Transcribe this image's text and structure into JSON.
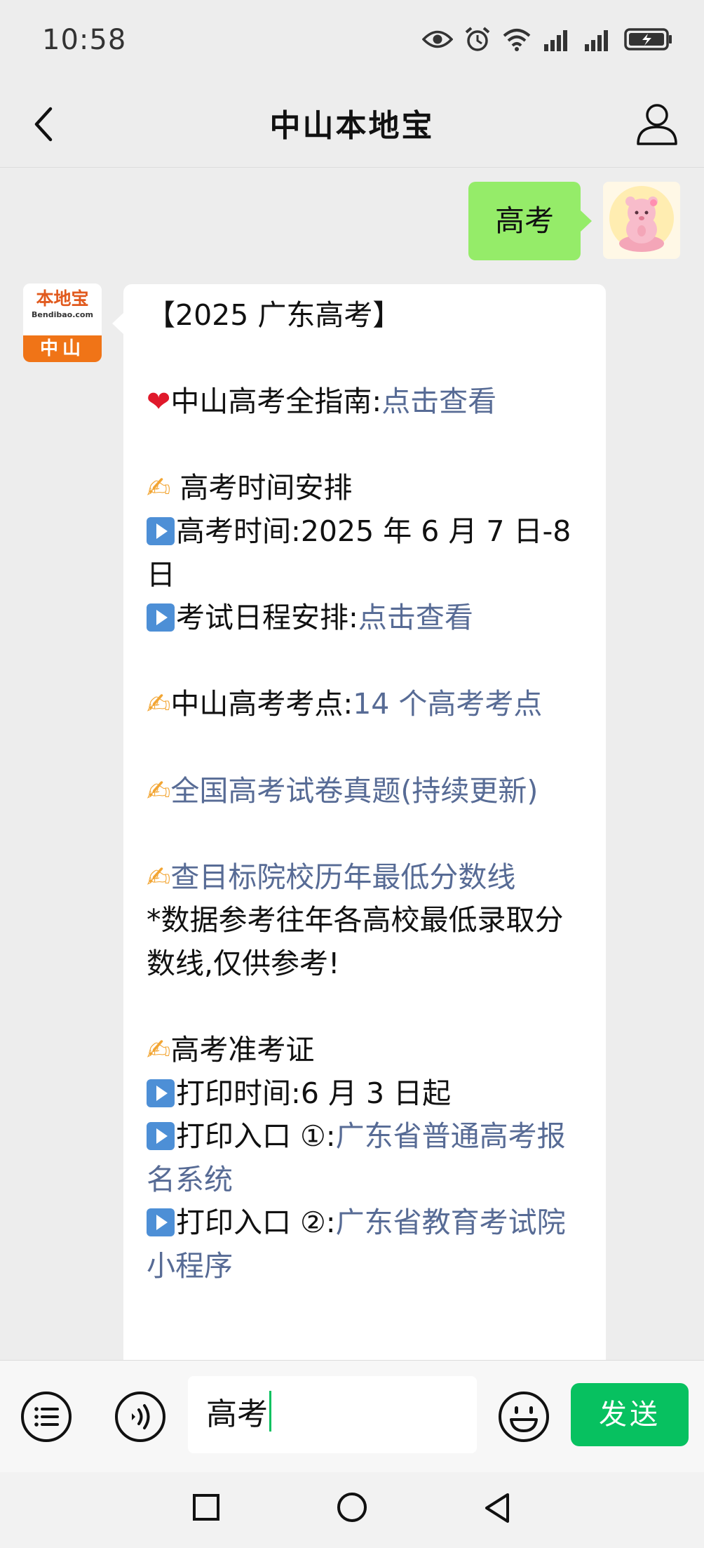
{
  "status_bar": {
    "time": "10:58",
    "icons": [
      "eye-icon",
      "alarm-icon",
      "wifi-icon",
      "signal-icon",
      "signal-icon",
      "battery-charging-icon"
    ]
  },
  "nav": {
    "title": "中山本地宝",
    "back_icon": "chevron-left-icon",
    "profile_icon": "person-icon"
  },
  "chat": {
    "outgoing": {
      "text": "高考"
    },
    "bot_avatar": {
      "brand": "本地宝",
      "site": "Bendibao.com",
      "city": "中山"
    },
    "bot_message": {
      "title": "【2025 广东高考】",
      "guide_label": "中山高考全指南:",
      "guide_link": "点击查看",
      "schedule_heading": " 高考时间安排",
      "exam_time_label": "高考时间:",
      "exam_time_value": "2025 年 6 月 7 日-8 日",
      "schedule_label": "考试日程安排:",
      "schedule_link": "点击查看",
      "sites_label": "中山高考考点:",
      "sites_link": "14 个高考考点",
      "papers_link": "全国高考试卷真题(持续更新)",
      "scores_link": "查目标院校历年最低分数线",
      "scores_note": "*数据参考往年各高校最低录取分数线,仅供参考!",
      "admission_heading": "高考准考证",
      "print_time_label": "打印时间:",
      "print_time_value": "6 月 3 日起",
      "print_entry1_label": "打印入口 ①:",
      "print_entry1_link": "广东省普通高考报名系统",
      "print_entry2_label": "打印入口 ②:",
      "print_entry2_link": "广东省教育考试院小程序"
    }
  },
  "input_bar": {
    "value": "高考",
    "send_label": "发送"
  },
  "colors": {
    "self_bubble": "#95ec69",
    "link": "#576b95",
    "send_button": "#07c160",
    "brand_orange": "#f07417"
  }
}
